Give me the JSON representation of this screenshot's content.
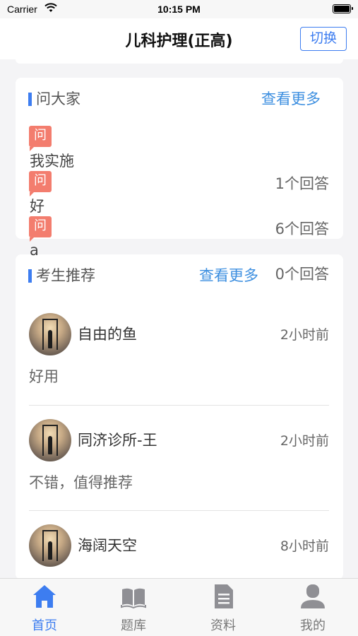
{
  "status_bar": {
    "carrier": "Carrier",
    "time": "10:15 PM"
  },
  "nav": {
    "title": "儿科护理(正高)",
    "switch_label": "切换"
  },
  "ask": {
    "title": "问大家",
    "more": "查看更多",
    "badge": "问",
    "questions": [
      {
        "text": "我实施",
        "answers": "1个回答"
      },
      {
        "text": "好",
        "answers": "6个回答"
      },
      {
        "text": "a",
        "answers": "0个回答"
      }
    ]
  },
  "recommend": {
    "title": "考生推荐",
    "more": "查看更多",
    "items": [
      {
        "name": "自由的鱼",
        "time": "2小时前",
        "comment": "好用"
      },
      {
        "name": "同济诊所-王",
        "time": "2小时前",
        "comment": "不错，值得推荐"
      },
      {
        "name": "海阔天空",
        "time": "8小时前",
        "comment": ""
      }
    ]
  },
  "tabbar": {
    "accent": "#3d7df0",
    "tabs": [
      {
        "label": "首页",
        "icon": "home-icon",
        "active": true
      },
      {
        "label": "题库",
        "icon": "book-icon",
        "active": false
      },
      {
        "label": "资料",
        "icon": "document-icon",
        "active": false
      },
      {
        "label": "我的",
        "icon": "user-icon",
        "active": false
      }
    ]
  }
}
